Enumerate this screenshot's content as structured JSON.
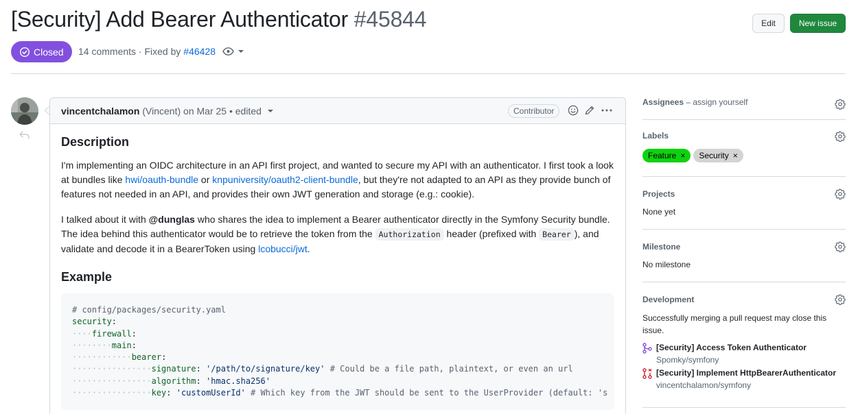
{
  "issue": {
    "title": "[Security] Add Bearer Authenticator",
    "number": "#45844",
    "state": "Closed",
    "comments": "14 comments",
    "fixed_by_prefix": " · Fixed by ",
    "fixed_by": "#46428",
    "state_color": "#8250df"
  },
  "header": {
    "edit_label": "Edit",
    "new_issue_label": "New issue",
    "new_issue_color": "#1f883d"
  },
  "comment": {
    "author": "vincentchalamon",
    "meta": "(Vincent) on Mar 25 • edited",
    "role_badge": "Contributor",
    "heading_description": "Description",
    "p1_a": "I'm implementing an OIDC architecture in an API first project, and wanted to secure my API with an authenticator. I first took a look at bundles like ",
    "link1": "hwi/oauth-bundle",
    "p1_b": " or ",
    "link2": "knpuniversity/oauth2-client-bundle",
    "p1_c": ", but they're not adapted to an API as they provide bunch of features not needed in an API, and provides their own JWT generation and storage (e.g.: cookie).",
    "p2_a": "I talked about it with ",
    "mention": "@dunglas",
    "p2_b": " who shares the idea to implement a Bearer authenticator directly in the Symfony Security bundle. The idea behind this authenticator would be to retrieve the token from the ",
    "code1": "Authorization",
    "p2_c": " header (prefixed with ",
    "code2": "Bearer",
    "p2_d": "), and validate and decode it in a BearerToken using ",
    "link3": "lcobucci/jwt",
    "p2_e": ".",
    "heading_example": "Example",
    "code_lines": [
      {
        "indent": "",
        "key": "",
        "colon": "",
        "value": "",
        "comment": "# config/packages/security.yaml"
      },
      {
        "indent": "",
        "key": "security",
        "colon": ":",
        "value": "",
        "comment": ""
      },
      {
        "indent": "····",
        "key": "firewall",
        "colon": ":",
        "value": "",
        "comment": ""
      },
      {
        "indent": "········",
        "key": "main",
        "colon": ":",
        "value": "",
        "comment": ""
      },
      {
        "indent": "············",
        "key": "bearer",
        "colon": ":",
        "value": "",
        "comment": ""
      },
      {
        "indent": "················",
        "key": "signature",
        "colon": ": ",
        "value": "'/path/to/signature/key'",
        "comment": " # Could be a file path, plaintext, or even an url"
      },
      {
        "indent": "················",
        "key": "algorithm",
        "colon": ": ",
        "value": "'hmac.sha256'",
        "comment": ""
      },
      {
        "indent": "················",
        "key": "key",
        "colon": ": ",
        "value": "'customUserId'",
        "comment": " # Which key from the JWT should be sent to the UserProvider (default: 's"
      }
    ]
  },
  "sidebar": {
    "assignees_title": "Assignees",
    "assignees_hint": " – assign yourself",
    "labels_title": "Labels",
    "labels": [
      {
        "name": "Feature",
        "color": "#0fd20f",
        "text_color": "#000000"
      },
      {
        "name": "Security",
        "color": "#d4d4d4",
        "text_color": "#000000"
      }
    ],
    "projects_title": "Projects",
    "projects_value": "None yet",
    "milestone_title": "Milestone",
    "milestone_value": "No milestone",
    "development_title": "Development",
    "development_text": "Successfully merging a pull request may close this issue.",
    "prs": [
      {
        "title": "[Security] Access Token Authenticator",
        "repo": "Spomky/symfony",
        "icon": "git-merged-icon",
        "color": "#8250df"
      },
      {
        "title": "[Security] Implement HttpBearerAuthenticator",
        "repo": "vincentchalamon/symfony",
        "icon": "git-pr-closed-icon",
        "color": "#d1242f"
      }
    ]
  }
}
